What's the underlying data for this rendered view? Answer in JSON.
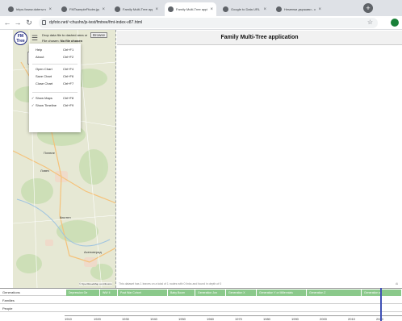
{
  "browser": {
    "tabs": [
      {
        "title": "https://www.dotenv.net/ i"
      },
      {
        "title": "FMTsampleFfudm.jpg (87)"
      },
      {
        "title": "Family Multi-Tree applicatio"
      },
      {
        "title": "Family Multi-Tree applicati"
      },
      {
        "title": "Google to Data URL Conver"
      },
      {
        "title": "Неменки държави - светоп"
      }
    ],
    "active_tab": 3,
    "url": "dyfoto.net/~chushn/js-test/fmtree/fmt-index-v87.html"
  },
  "app": {
    "title": "Family Multi-Tree application",
    "logo": "FM Tree",
    "drop_text": "Drop data file to dashed area or",
    "browse_label": "Browse",
    "file_chosen_prefix": "File chosen:",
    "file_chosen_value": "No file chosen",
    "menu": [
      {
        "label": "Help",
        "key": "Ctrl+F1",
        "checked": false
      },
      {
        "label": "About",
        "key": "Ctrl+F2",
        "checked": false
      },
      {
        "label": "Open Chart",
        "key": "Ctrl+F4",
        "checked": false
      },
      {
        "label": "Save Chart",
        "key": "Ctrl+F6",
        "checked": false
      },
      {
        "label": "Close Chart",
        "key": "Ctrl+F7",
        "checked": false
      },
      {
        "label": "Show Maps",
        "key": "Ctrl+F8",
        "checked": true
      },
      {
        "label": "Show Timeline",
        "key": "Ctrl+F9",
        "checked": true
      }
    ],
    "check_mark": "✓",
    "zoom_in": "+",
    "zoom_out": "−",
    "map_labels": [
      "Плевне",
      "Ловеч",
      "Асеновград",
      "Кюстел"
    ],
    "attribution": "© OpenStreetMap contributors",
    "status": "This dataset has 1 leaves on a total of 1 nodes with 0 links and found in depth of 0",
    "edge_label": "Ai"
  },
  "timeline": {
    "rows": [
      "Generations",
      "Families",
      "People"
    ],
    "segments": [
      {
        "label": "Depression Ge"
      },
      {
        "label": "WW II"
      },
      {
        "label": "Post War Cohort"
      },
      {
        "label": "Baby Boom"
      },
      {
        "label": "Generation Jon"
      },
      {
        "label": "Generation X"
      },
      {
        "label": "Generation Y or Millennials"
      },
      {
        "label": "Generation Z"
      },
      {
        "label": "Generation α"
      }
    ],
    "ticks": [
      "1910",
      "1920",
      "1930",
      "1940",
      "1950",
      "1960",
      "1970",
      "1980",
      "1990",
      "2000",
      "2010",
      "2020"
    ],
    "accent": "#8bc98b"
  }
}
